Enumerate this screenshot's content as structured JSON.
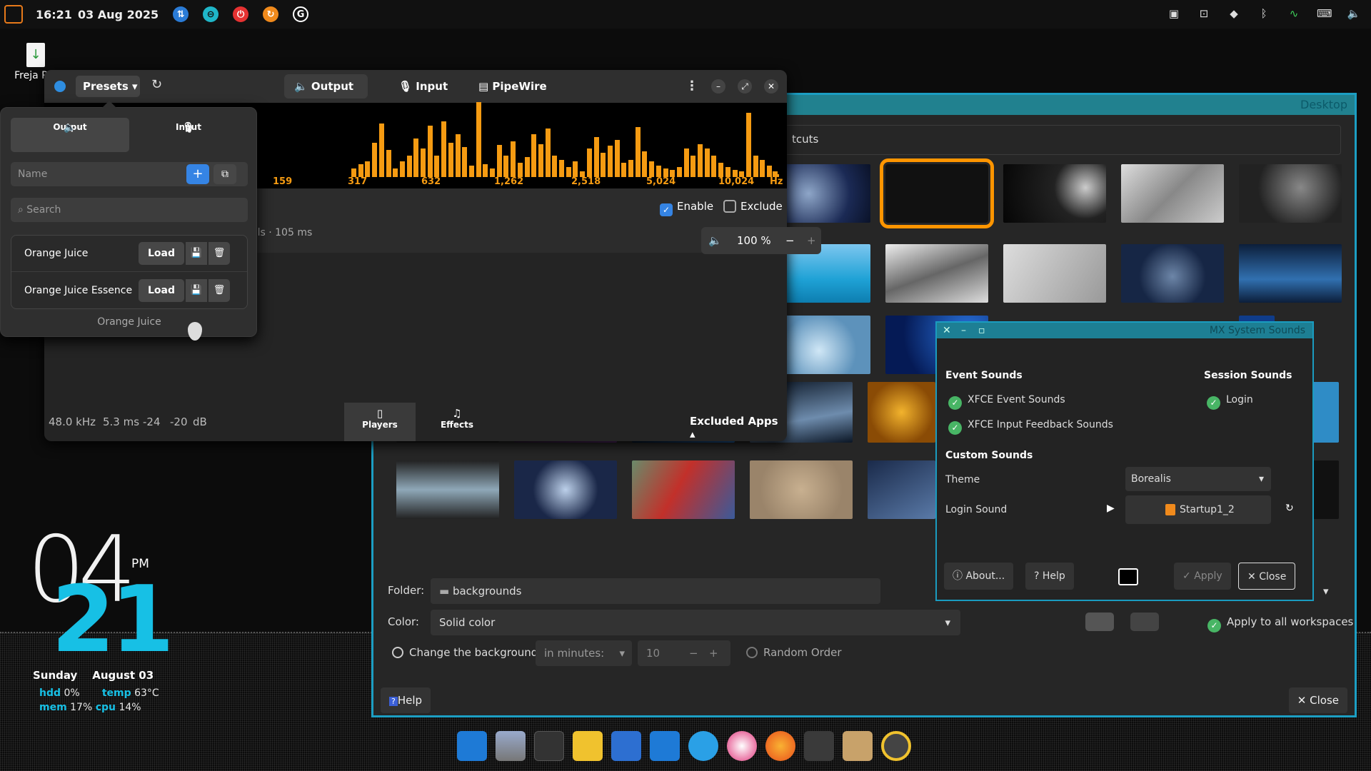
{
  "topbar": {
    "time": "16:21",
    "date": "03 Aug 2025"
  },
  "desktop_file": {
    "label": "Freja R"
  },
  "clock": {
    "hour": "04",
    "minute": "21",
    "ampm": "PM",
    "day": "Sunday",
    "date": "August 03",
    "stats": [
      {
        "k": "hdd",
        "v": "0%"
      },
      {
        "k": "temp",
        "v": "63°C"
      },
      {
        "k": "mem",
        "v": "17%"
      },
      {
        "k": "cpu",
        "v": "14%"
      }
    ]
  },
  "easyeffects": {
    "presets_label": "Presets",
    "tabs": [
      "Output",
      "Input",
      "PipeWire"
    ],
    "spectrum_labels": [
      "159",
      "317",
      "632",
      "1,262",
      "2,518",
      "5,024",
      "10,024",
      "Hz"
    ],
    "enable_label": "Enable",
    "exclude_label": "Exclude",
    "info_text": "els · 105 ms",
    "volume": "100 %",
    "status": [
      "48.0 kHz",
      "5.3 ms",
      "-24",
      "-20",
      "dB"
    ],
    "footer_tabs": [
      "Players",
      "Effects"
    ],
    "excluded_apps": "Excluded Apps"
  },
  "presets_popover": {
    "seg": [
      "Output",
      "Input"
    ],
    "name_placeholder": "Name",
    "search_placeholder": "Search",
    "items": [
      {
        "name": "Orange Juice",
        "load": "Load"
      },
      {
        "name": "Orange Juice Essence",
        "load": "Load"
      }
    ],
    "current": "Orange Juice"
  },
  "desktop_settings": {
    "title": "Desktop",
    "tab_fragment": "tcuts",
    "folder_label": "Folder:",
    "folder_value": "backgrounds",
    "color_label": "Color:",
    "color_value": "Solid color",
    "apply_all": "Apply to all workspaces",
    "change_bg": "Change the background",
    "interval": "in minutes:",
    "interval_value": "10",
    "random": "Random Order",
    "help": "Help",
    "close": "Close"
  },
  "mx_sounds": {
    "title": "MX System Sounds",
    "event_title": "Event Sounds",
    "event_items": [
      "XFCE Event Sounds",
      "XFCE Input Feedback Sounds"
    ],
    "session_title": "Session Sounds",
    "session_items": [
      "Login"
    ],
    "custom_title": "Custom Sounds",
    "theme_label": "Theme",
    "theme_value": "Borealis",
    "login_sound_label": "Login Sound",
    "login_sound_value": "Startup1_2",
    "buttons": {
      "about": "About...",
      "help": "Help",
      "apply": "Apply",
      "close": "Close"
    }
  },
  "colors": {
    "accent": "#ff9500",
    "cyan": "#17c0e5",
    "blue": "#3584e4",
    "green": "#48b565"
  }
}
